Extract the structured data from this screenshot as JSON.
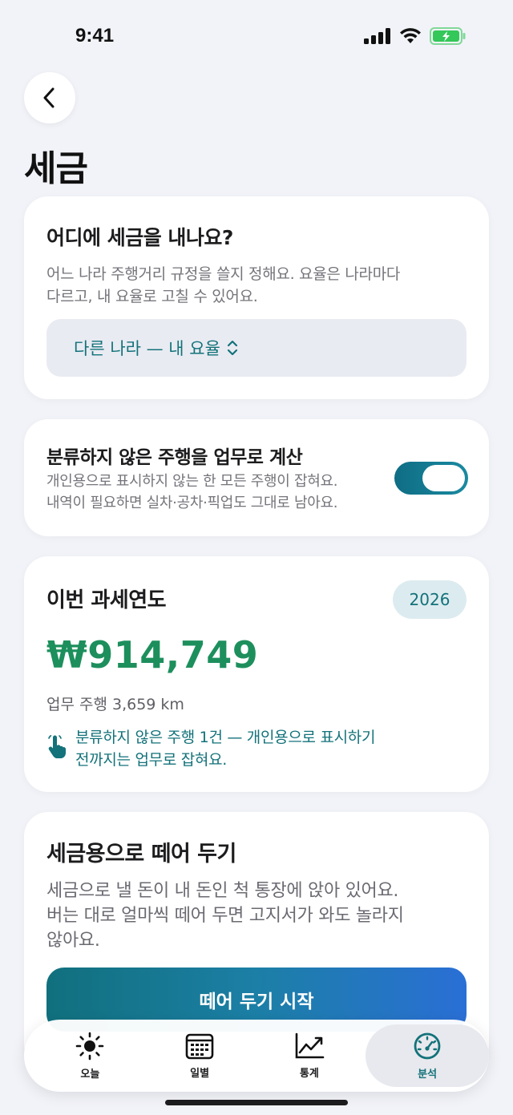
{
  "status": {
    "time": "9:41"
  },
  "header": {
    "title": "세금"
  },
  "country_card": {
    "title": "어디에 세금을 내나요?",
    "desc_line1": "어느 나라 주행거리 규정을 쓸지 정해요. 요율은 나라마다",
    "desc_line2": "다르고, 내 요율로 고칠 수 있어요.",
    "selected": "다른 나라 — 내 요율"
  },
  "unclassified_card": {
    "title": "분류하지 않은 주행을 업무로 계산",
    "desc_line1": "개인용으로 표시하지 않는 한 모든 주행이 잡혀요.",
    "desc_line2": "내역이 필요하면 실차·공차·픽업도 그대로 남아요.",
    "toggle_on": true
  },
  "tax_year_card": {
    "title": "이번 과세연도",
    "year": "2026",
    "amount": "₩914,749",
    "distance": "업무 주행 3,659 km",
    "note_line1": "분류하지 않은 주행 1건 — 개인용으로 표시하기",
    "note_line2": "전까지는 업무로 잡혀요."
  },
  "setaside_card": {
    "title": "세금용으로 떼어 두기",
    "desc_line1": "세금으로 낼 돈이 내 돈인 척 통장에 앉아 있어요.",
    "desc_line2": "버는 대로 얼마씩 떼어 두면 고지서가 와도 놀라지",
    "desc_line3": "않아요.",
    "button": "떼어 두기 시작"
  },
  "tabs": [
    {
      "label": "오늘",
      "icon": "sun-icon"
    },
    {
      "label": "일별",
      "icon": "calendar-icon"
    },
    {
      "label": "통계",
      "icon": "chart-icon"
    },
    {
      "label": "분석",
      "icon": "gauge-icon"
    }
  ],
  "colors": {
    "accent": "#13727a",
    "amount": "#1d8f5c",
    "background": "#f2f3f8"
  }
}
